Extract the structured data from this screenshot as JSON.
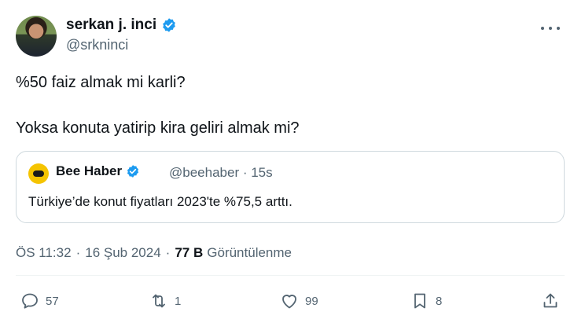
{
  "author": {
    "name": "serkan j. inci",
    "handle": "@srkninci"
  },
  "tweet": {
    "line1": "%50 faiz almak mi karli?",
    "line2": "Yoksa konuta yatirip kira geliri almak mi?"
  },
  "quote": {
    "name": "Bee Haber",
    "handle": "@beehaber · 15s",
    "text": "Türkiye’de konut fiyatları 2023'te %75,5 arttı."
  },
  "meta": {
    "time": "ÖS 11:32",
    "dot": "·",
    "date": "16 Şub 2024",
    "views_count": "77 B",
    "views_label": "Görüntülenme"
  },
  "actions": {
    "replies": "57",
    "reposts": "1",
    "likes": "99",
    "bookmarks": "8"
  },
  "colors": {
    "verified": "#1d9bf0",
    "secondary_text": "#536471",
    "border": "#cfd9de"
  }
}
